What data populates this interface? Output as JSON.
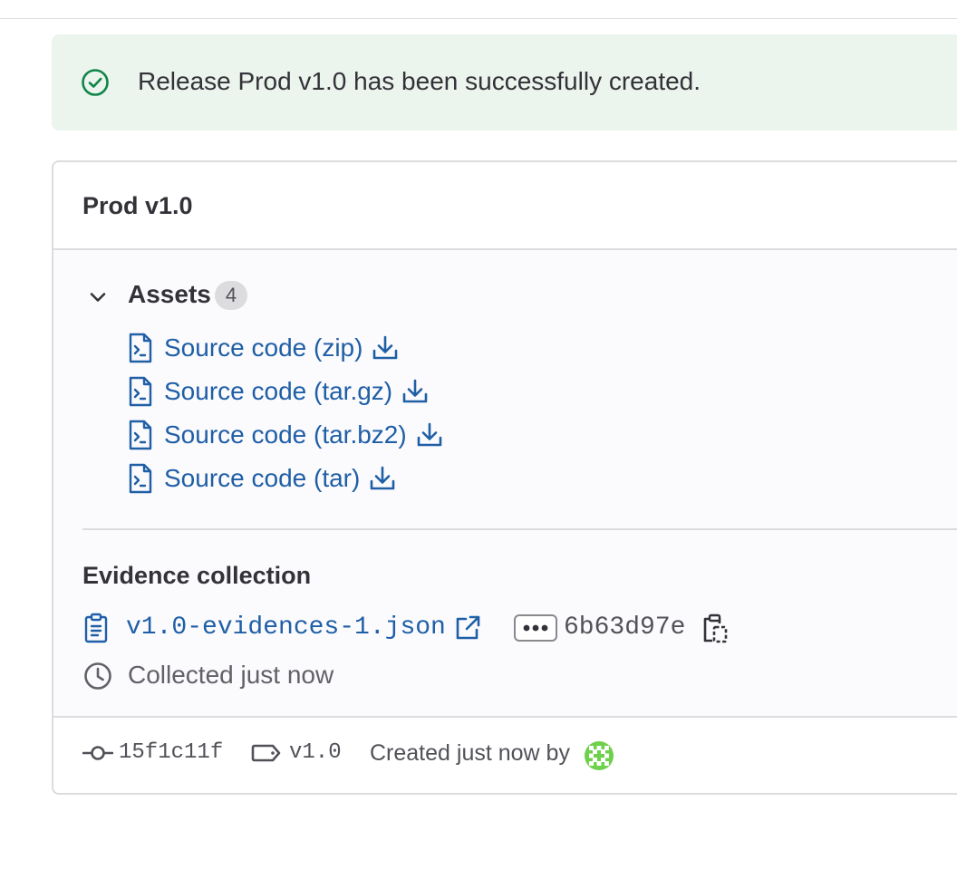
{
  "alert": {
    "message": "Release Prod v1.0 has been successfully created.",
    "icon": "check-circle-icon",
    "color": "#108548"
  },
  "release": {
    "title": "Prod v1.0",
    "assets": {
      "label": "Assets",
      "count": "4",
      "items": [
        {
          "label": "Source code (zip)"
        },
        {
          "label": "Source code (tar.gz)"
        },
        {
          "label": "Source code (tar.bz2)"
        },
        {
          "label": "Source code (tar)"
        }
      ]
    },
    "evidence": {
      "title": "Evidence collection",
      "file": "v1.0-evidences-1.json",
      "sha": "6b63d97e",
      "collected": "Collected just now"
    },
    "footer": {
      "commit": "15f1c11f",
      "tag": "v1.0",
      "created": "Created just now by"
    }
  },
  "colors": {
    "link": "#1f5fa6",
    "text": "#333238",
    "border": "#dcdcde",
    "alert_bg": "#ecf4ee",
    "body_bg": "#fbfafd"
  }
}
